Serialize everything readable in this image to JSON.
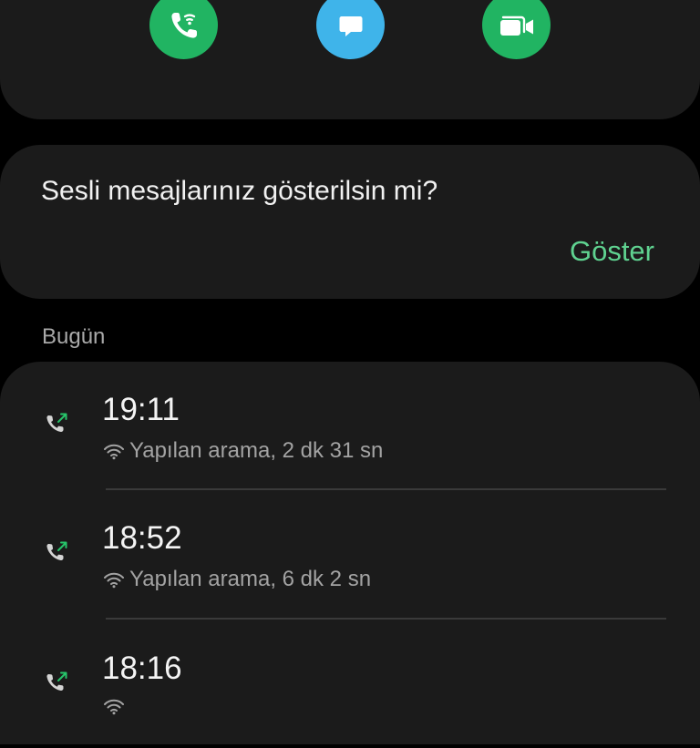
{
  "actions": {
    "call_icon": "wifi-call-icon",
    "message_icon": "message-icon",
    "video_icon": "video-call-icon",
    "colors": {
      "call": "#21b462",
      "message": "#3fb4ea",
      "video": "#21b462"
    }
  },
  "voicemail": {
    "prompt": "Sesli mesajlarınız gösterilsin mi?",
    "show_label": "Göster",
    "accent": "#5fd290"
  },
  "history": {
    "section_label": "Bugün",
    "items": [
      {
        "time": "19:11",
        "detail": "Yapılan arama, 2 dk 31 sn",
        "icon": "outgoing-call-icon"
      },
      {
        "time": "18:52",
        "detail": "Yapılan arama, 6 dk 2 sn",
        "icon": "outgoing-call-icon"
      },
      {
        "time": "18:16",
        "detail": "",
        "icon": "outgoing-call-icon"
      }
    ]
  }
}
